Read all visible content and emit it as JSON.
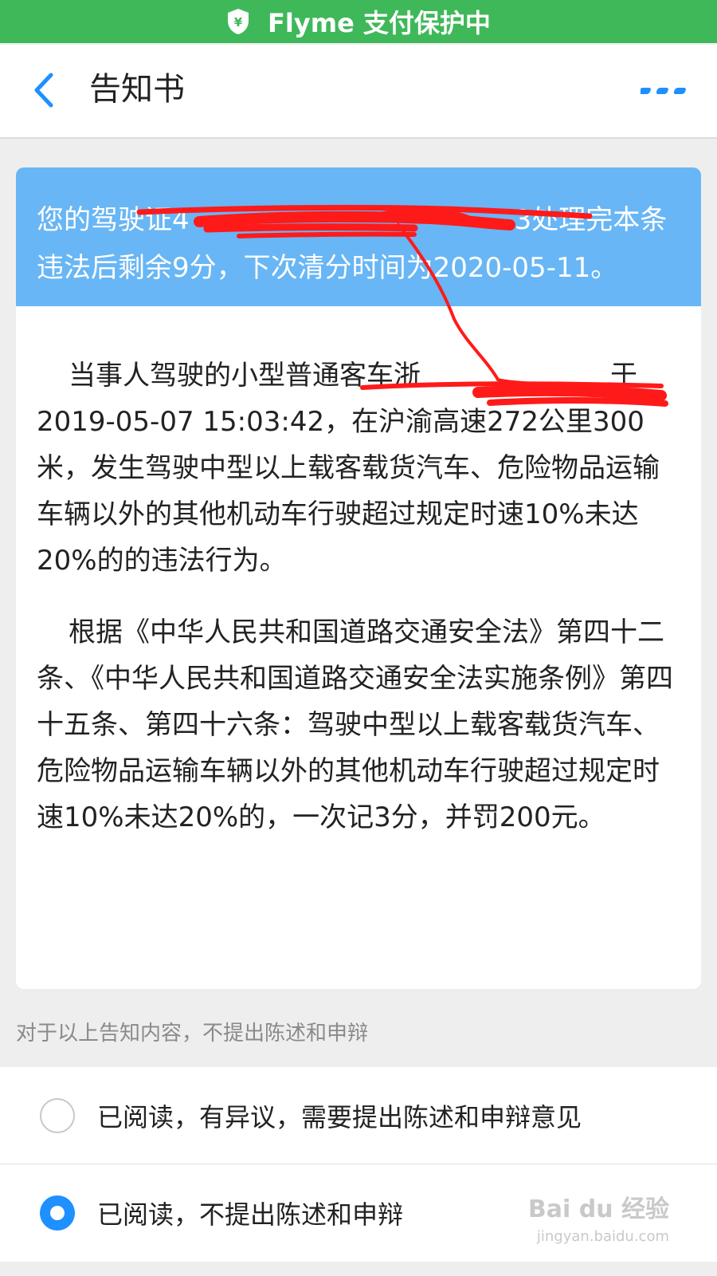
{
  "status_bar": {
    "text": "Flyme 支付保护中",
    "color": "#3fb85a"
  },
  "header": {
    "title": "告知书",
    "back_icon": "chevron-left-icon",
    "more_icon": "more-dots-icon",
    "accent": "#1e90ff"
  },
  "card": {
    "summary": "您的驾驶证4　　　　　　　　　　　　3处理完本条违法后剩余9分，下次清分时间为2020-05-11。",
    "paragraph1": "当事人驾驶的小型普通客车浙　　　　　　　于2019-05-07 15:03:42，在沪渝高速272公里300米，发生驾驶中型以上载客载货汽车、危险物品运输车辆以外的其他机动车行驶超过规定时速10%未达20%的的违法行为。",
    "paragraph2": "根据《中华人民共和国道路交通安全法》第四十二条、《中华人民共和国道路交通安全法实施条例》第四十五条、第四十六条：驾驶中型以上载客载货汽车、危险物品运输车辆以外的其他机动车行驶超过规定时速10%未达20%的，一次记3分，并罚200元。",
    "header_color": "#68b6f5"
  },
  "hint": "对于以上告知内容，不提出陈述和申辩",
  "options": [
    {
      "label": "已阅读，有异议，需要提出陈述和申辩意见",
      "selected": false
    },
    {
      "label": "已阅读，不提出陈述和申辩",
      "selected": true
    }
  ],
  "watermark": {
    "main": "Bai du 经验",
    "sub": "jingyan.baidu.com"
  }
}
